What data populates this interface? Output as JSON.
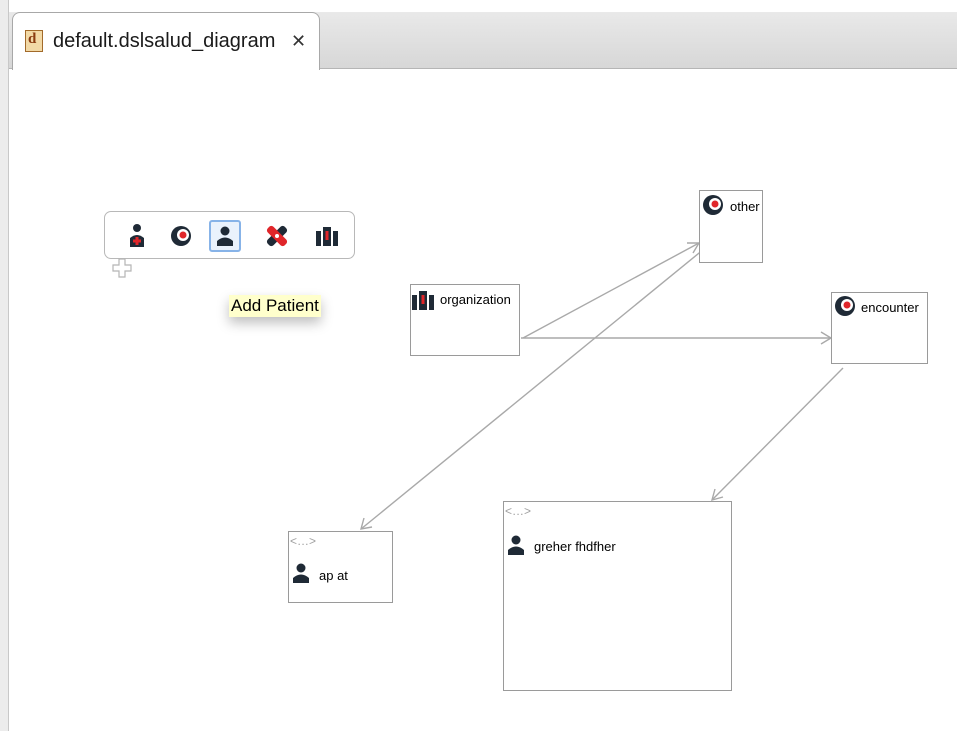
{
  "editor": {
    "tab_title": "default.dslsalud_diagram",
    "tab_file_icon_letter": "d",
    "tab_close_icon": "close-tab-icon"
  },
  "palette": {
    "items": [
      {
        "name": "practitioner-icon",
        "tooltip": "",
        "selected": false
      },
      {
        "name": "other-event-icon",
        "tooltip": "",
        "selected": false
      },
      {
        "name": "patient-icon",
        "tooltip": "Add Patient",
        "selected": true
      },
      {
        "name": "bandage-icon",
        "tooltip": "",
        "selected": false
      },
      {
        "name": "organization-icon",
        "tooltip": "",
        "selected": false
      }
    ],
    "expand_icon": "plus-outline-icon"
  },
  "tooltip": {
    "text": "Add Patient"
  },
  "nodes": {
    "organization": {
      "label": "organization",
      "icon": "organization-icon"
    },
    "other": {
      "label": "other",
      "icon": "other-event-icon"
    },
    "encounter": {
      "label": "encounter",
      "icon": "encounter-icon"
    },
    "patient_ap": {
      "stereotype": "<...>",
      "label": "ap at",
      "icon": "patient-icon"
    },
    "patient_greher": {
      "stereotype": "<...>",
      "label": "greher fhdfher",
      "icon": "patient-icon"
    }
  },
  "connections": [
    {
      "from": "organization",
      "to": "other"
    },
    {
      "from": "organization",
      "to": "encounter"
    },
    {
      "from": "other",
      "to": "patient_ap"
    },
    {
      "from": "encounter",
      "to": "patient_greher"
    }
  ],
  "colors": {
    "connector": "#a9a9a9",
    "node_border": "#9a9a9a",
    "tooltip_bg": "#ffffcc",
    "selection": "#87b3e8",
    "icon_dark": "#1f2a36",
    "icon_red": "#e0262a"
  }
}
